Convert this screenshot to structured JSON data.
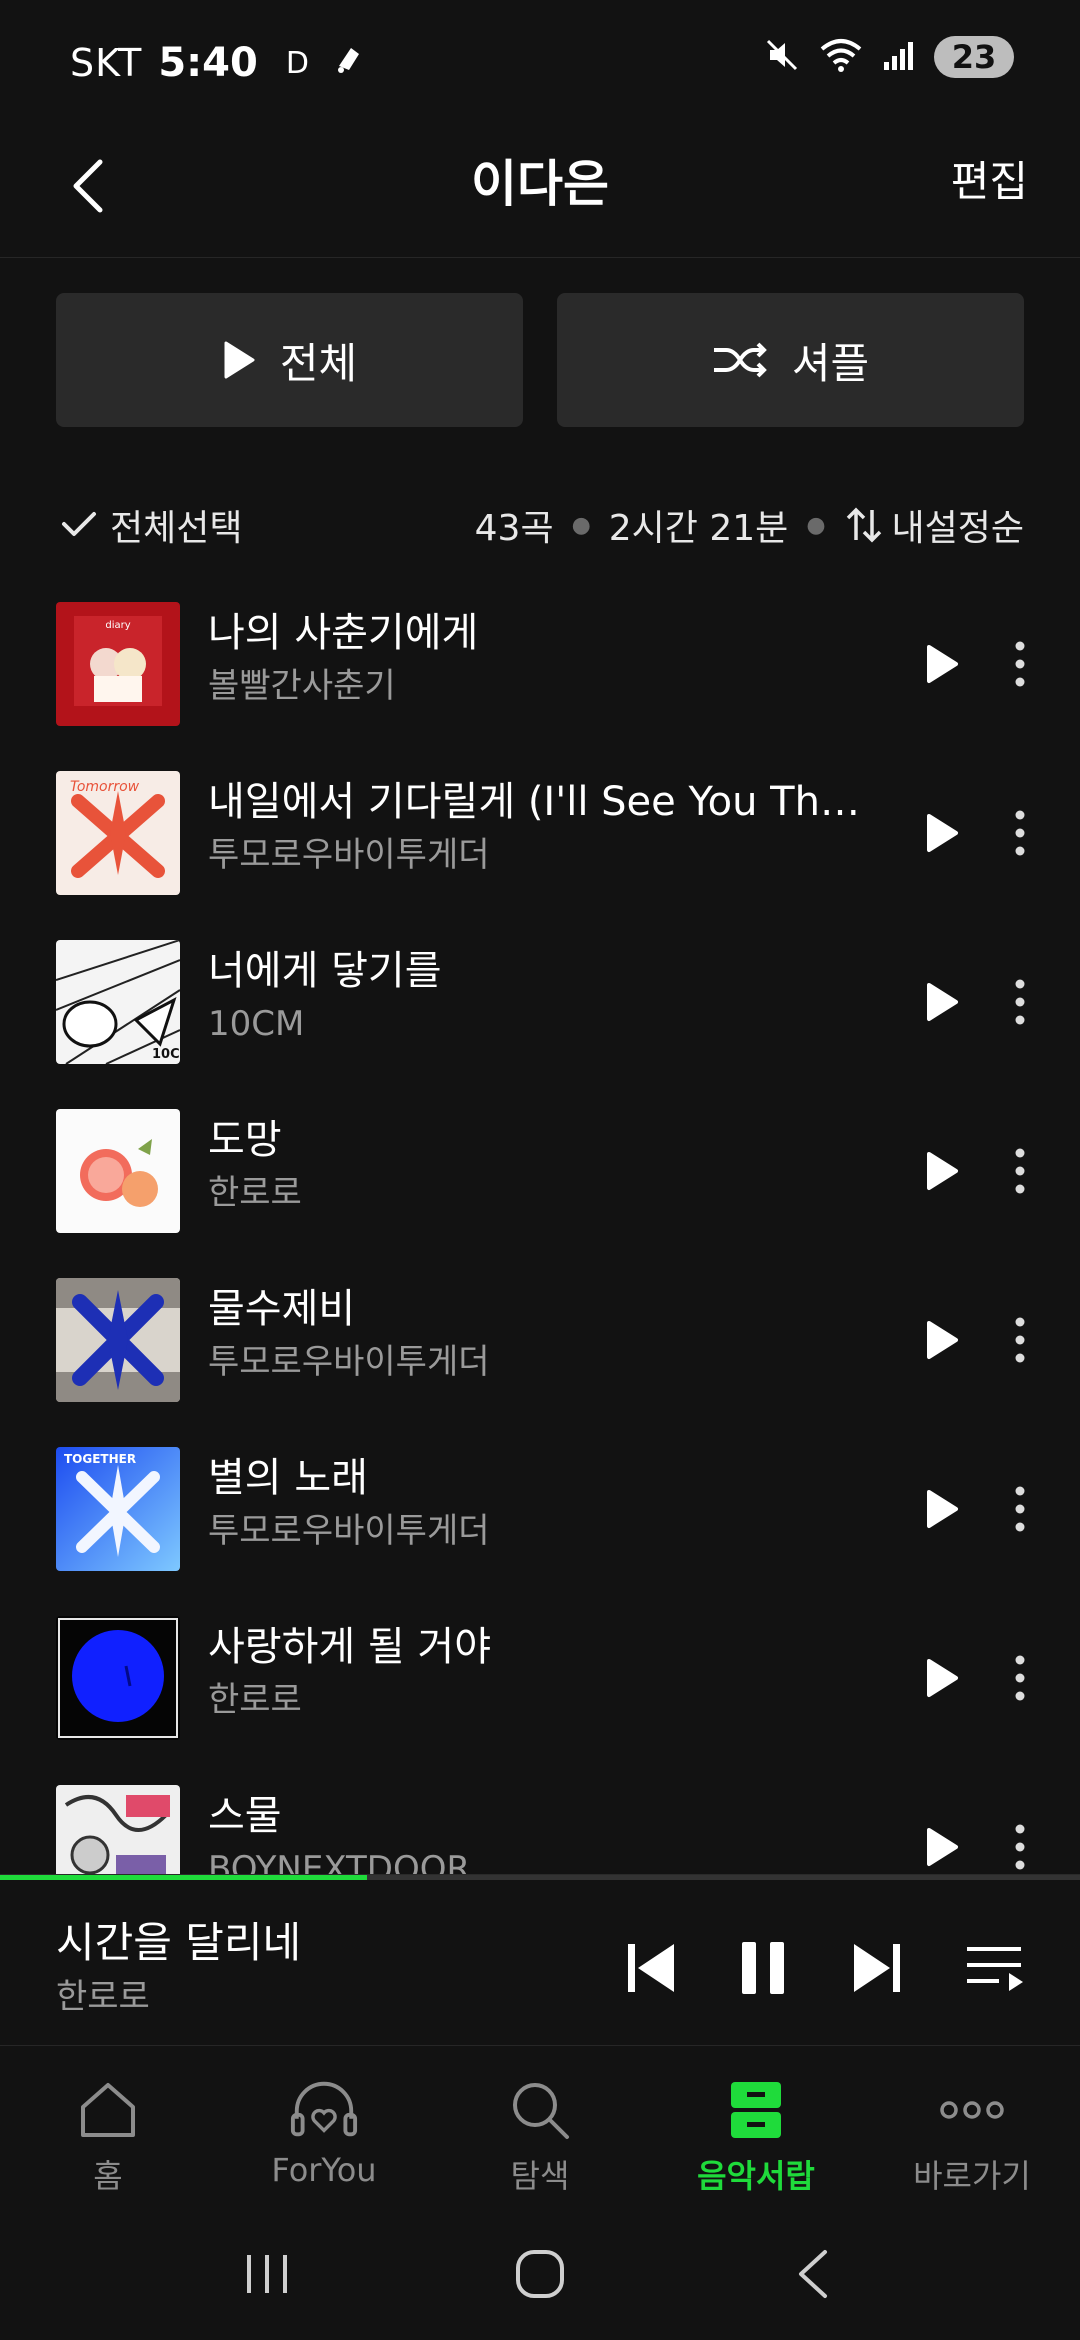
{
  "status_bar": {
    "carrier": "SKT",
    "time": "5:40",
    "mode_letter": "D",
    "battery": "23"
  },
  "header": {
    "title": "이다은",
    "edit_label": "편집"
  },
  "actions": {
    "play_all_label": "전체",
    "shuffle_label": "셔플"
  },
  "list_meta": {
    "select_all_label": "전체선택",
    "song_count": "43곡",
    "duration": "2시간 21분",
    "sort_label": "내설정순"
  },
  "songs": [
    {
      "title": "나의 사춘기에게",
      "artist": "볼빨간사춘기"
    },
    {
      "title": "내일에서 기다릴게 (I'll See You There Tomorrow)",
      "artist": "투모로우바이투게더"
    },
    {
      "title": "너에게 닿기를",
      "artist": "10CM"
    },
    {
      "title": "도망",
      "artist": "한로로"
    },
    {
      "title": "물수제비",
      "artist": "투모로우바이투게더"
    },
    {
      "title": "별의 노래",
      "artist": "투모로우바이투게더"
    },
    {
      "title": "사랑하게 될 거야",
      "artist": "한로로"
    },
    {
      "title": "스물",
      "artist": "BOYNEXTDOOR"
    }
  ],
  "now_playing": {
    "title": "시간을 달리네",
    "artist": "한로로",
    "progress": 0.34
  },
  "bottom_nav": [
    {
      "label": "홈",
      "icon": "home-icon"
    },
    {
      "label": "ForYou",
      "icon": "headphones-heart-icon"
    },
    {
      "label": "탐색",
      "icon": "search-icon"
    },
    {
      "label": "음악서랍",
      "icon": "drawer-icon",
      "active": true
    },
    {
      "label": "바로가기",
      "icon": "more-dots-icon"
    }
  ],
  "colors": {
    "background": "#121212",
    "accent_green": "#1fdb3b",
    "button_bg": "#2a2a2a",
    "secondary_text": "#9a9a9a"
  }
}
